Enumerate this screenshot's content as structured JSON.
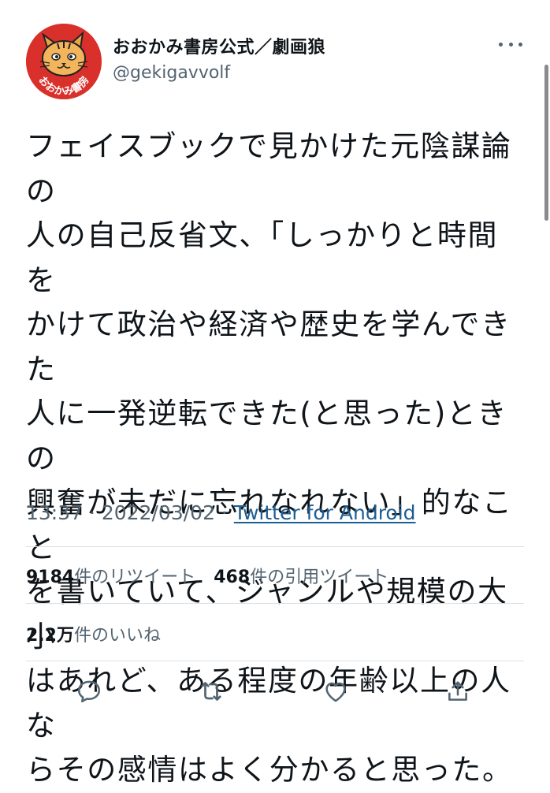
{
  "author": {
    "display_name": "おおかみ書房公式／劇画狼",
    "handle": "@gekigavvolf",
    "avatar_label": "おおかみ書房",
    "avatar_color": "#d9302c"
  },
  "tweet": {
    "text": "フェイスブックで見かけた元陰謀論の\n人の自己反省文、「しっかりと時間を\nかけて政治や経済や歴史を学んできた\n人に一発逆転できた(と思った)ときの\n興奮が未だに忘れなれない」的なこと\nを書いていて、ジャンルや規模の大小\nはあれど、ある程度の年齢以上の人な\nらその感情はよく分かると思った。",
    "time": "13:37",
    "separator": " · ",
    "date": "2022/03/02",
    "source": "Twitter for Android"
  },
  "stats": {
    "retweets_count": "9184",
    "retweets_label": "件のリツイート",
    "quotes_count": "468",
    "quotes_label": "件の引用ツイート",
    "likes_count": "2.2万",
    "likes_label": "件のいいね"
  },
  "actions": {
    "icons": [
      "reply-icon",
      "retweet-icon",
      "like-icon",
      "share-icon"
    ],
    "icon_color": "#536471"
  },
  "colors": {
    "text": "#0f1419",
    "secondary": "#536471",
    "link": "#1d5e95",
    "divider": "#dbdfe3"
  }
}
